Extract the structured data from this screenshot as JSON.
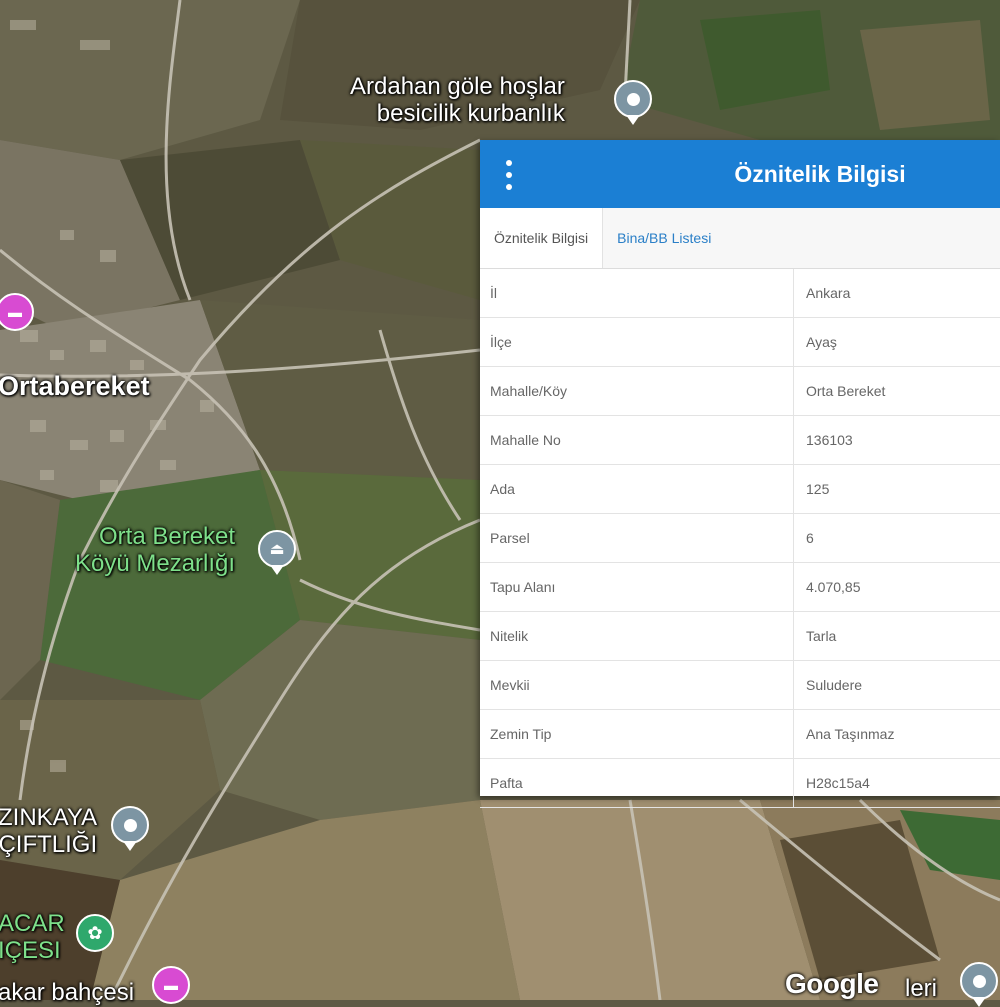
{
  "map": {
    "places": [
      {
        "line1": "Ardahan göle hoşlar",
        "line2": "besicilik kurbanlık",
        "icon": "pin-icon"
      },
      {
        "line1": "Ortabereket",
        "icon": "hotel-icon"
      },
      {
        "line1": "Orta Bereket",
        "line2": "Köyü Mezarlığı",
        "icon": "cemetery-icon"
      },
      {
        "line1": "ZINKAYA",
        "line2": "ÇIFTLIĞI",
        "icon": "pin-icon"
      },
      {
        "line1": "ACAR",
        "line2": "IÇESI",
        "icon": "flower-icon"
      },
      {
        "line1": "akar bahçesi",
        "icon": "hotel-icon"
      },
      {
        "line1": "leri",
        "icon": "pin-icon"
      }
    ],
    "attribution": "Google"
  },
  "panel": {
    "title": "Öznitelik Bilgisi",
    "tabs": [
      {
        "label": "Öznitelik Bilgisi",
        "active": true
      },
      {
        "label": "Bina/BB Listesi",
        "active": false
      }
    ],
    "rows": [
      {
        "key": "İl",
        "value": "Ankara"
      },
      {
        "key": "İlçe",
        "value": "Ayaş"
      },
      {
        "key": "Mahalle/Köy",
        "value": "Orta Bereket"
      },
      {
        "key": "Mahalle No",
        "value": "136103"
      },
      {
        "key": "Ada",
        "value": "125"
      },
      {
        "key": "Parsel",
        "value": "6"
      },
      {
        "key": "Tapu Alanı",
        "value": "4.070,85"
      },
      {
        "key": "Nitelik",
        "value": "Tarla"
      },
      {
        "key": "Mevkii",
        "value": "Suludere"
      },
      {
        "key": "Zemin Tip",
        "value": "Ana Taşınmaz"
      },
      {
        "key": "Pafta",
        "value": "H28c15a4"
      }
    ]
  },
  "colors": {
    "header": "#1b7fd4",
    "tab_link": "#2a7fc7",
    "pin_gray": "#7d95a3",
    "pin_pink": "#d84bd2",
    "pin_green": "#2fa86c"
  }
}
